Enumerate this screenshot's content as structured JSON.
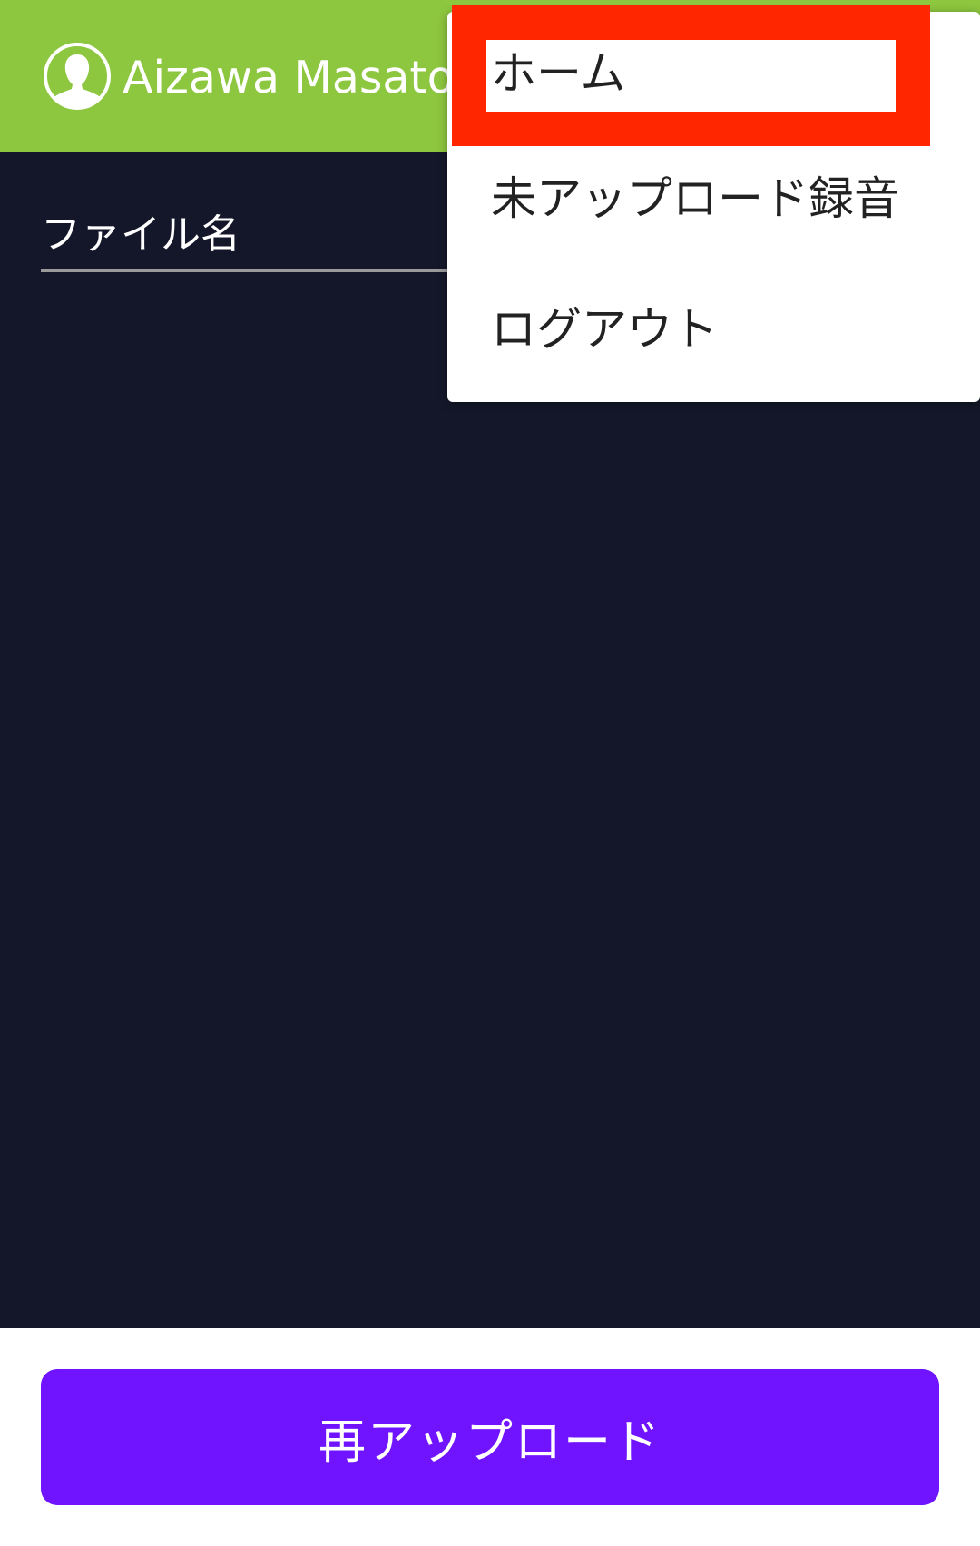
{
  "header": {
    "user_name": "Aizawa Masato",
    "avatar_icon": "user-avatar-icon",
    "background_color": "#8dc63f"
  },
  "main": {
    "file_name_label": "ファイル名",
    "background_color": "#131729"
  },
  "menu": {
    "items": [
      {
        "label": "ホーム",
        "highlighted": true
      },
      {
        "label": "未アップロード録音"
      },
      {
        "label": "ログアウト"
      }
    ],
    "highlight_color": "#ff2600"
  },
  "footer": {
    "reupload_label": "再アップロード",
    "button_color": "#7014ff"
  }
}
